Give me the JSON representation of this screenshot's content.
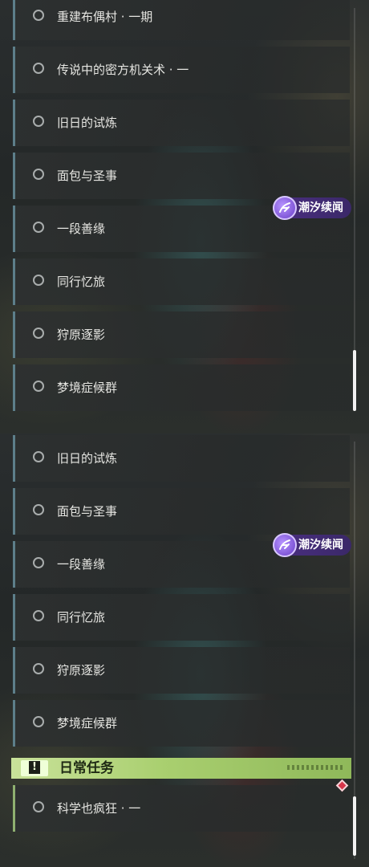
{
  "panel_top": {
    "quests": [
      {
        "title": "重建布偶村 · 一期"
      },
      {
        "title": "传说中的密方机关术 · 一"
      },
      {
        "title": "旧日的试炼"
      },
      {
        "title": "面包与圣事"
      },
      {
        "title": "一段善缘"
      },
      {
        "title": "同行忆旅"
      },
      {
        "title": "狩原逐影"
      },
      {
        "title": "梦境症候群"
      }
    ],
    "tag": {
      "label": "潮汐续闻",
      "icon": "tide-event-icon"
    }
  },
  "panel_bottom": {
    "quests": [
      {
        "title": "旧日的试炼"
      },
      {
        "title": "面包与圣事"
      },
      {
        "title": "一段善缘"
      },
      {
        "title": "同行忆旅"
      },
      {
        "title": "狩原逐影"
      },
      {
        "title": "梦境症候群"
      }
    ],
    "tag": {
      "label": "潮汐续闻",
      "icon": "tide-event-icon"
    },
    "daily_section": {
      "title": "日常任务",
      "icon": "exclamation-icon",
      "quests": [
        {
          "title": "科学也疯狂 · 一"
        }
      ],
      "marker_color": "#d7354a"
    }
  },
  "colors": {
    "quest_accent": "#5d7f8a",
    "daily_accent": "#8fb070",
    "tag_bg": "#4b2f82"
  }
}
